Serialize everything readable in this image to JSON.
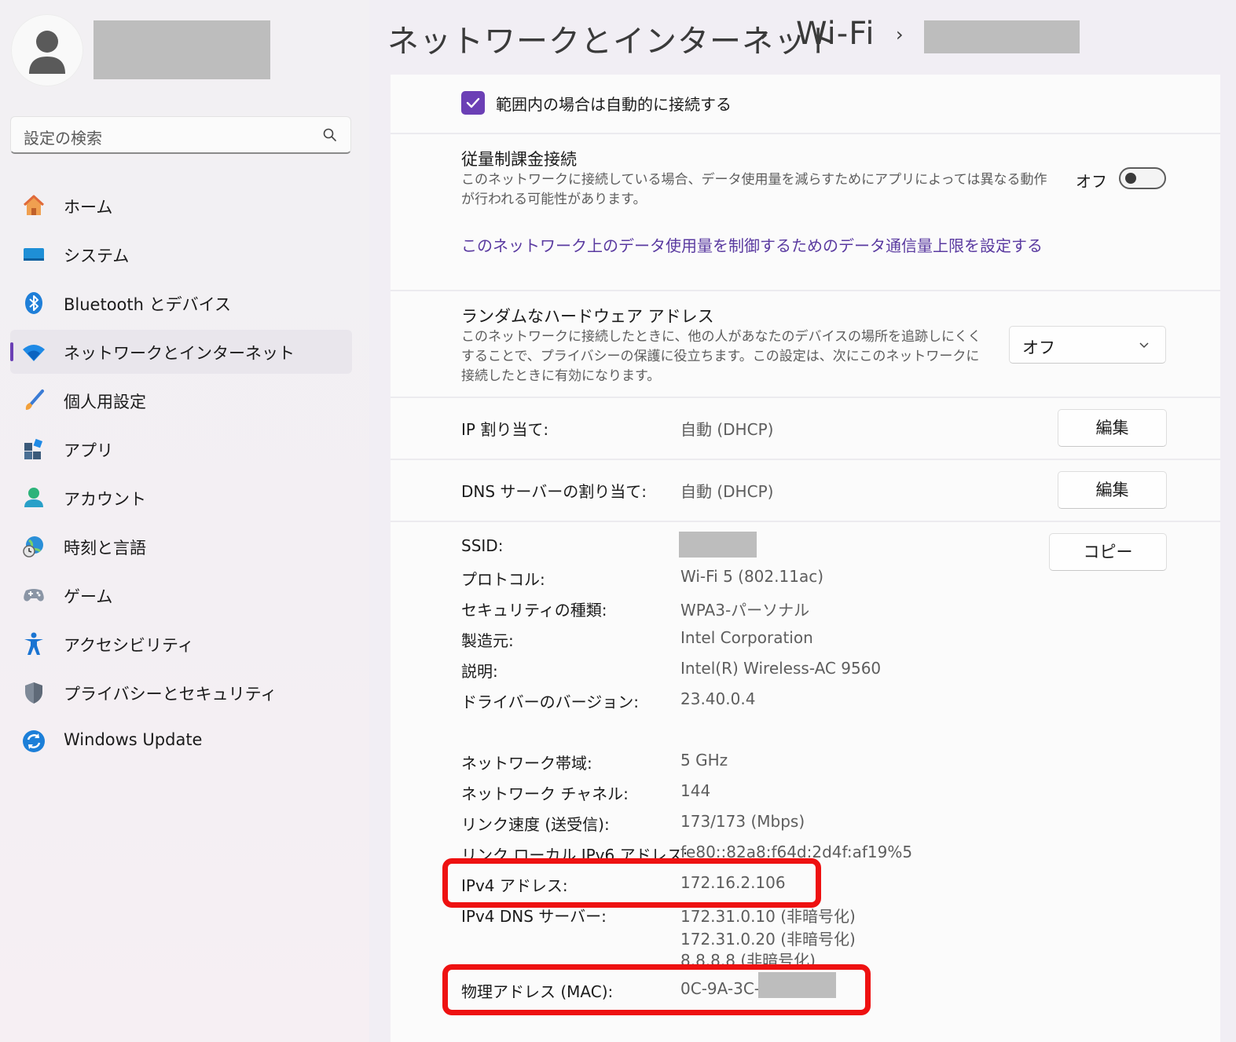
{
  "breadcrumb": {
    "part1": "ネットワークとインターネット",
    "sep": "›",
    "part2": "Wi-Fi"
  },
  "search": {
    "placeholder": "設定の検索"
  },
  "nav": [
    {
      "label": "ホーム",
      "icon": "home-icon"
    },
    {
      "label": "システム",
      "icon": "display-icon"
    },
    {
      "label": "Bluetooth とデバイス",
      "icon": "bluetooth-icon"
    },
    {
      "label": "ネットワークとインターネット",
      "icon": "wifi-icon",
      "active": true
    },
    {
      "label": "個人用設定",
      "icon": "brush-icon"
    },
    {
      "label": "アプリ",
      "icon": "apps-icon"
    },
    {
      "label": "アカウント",
      "icon": "account-icon"
    },
    {
      "label": "時刻と言語",
      "icon": "globe-clock-icon"
    },
    {
      "label": "ゲーム",
      "icon": "gamepad-icon"
    },
    {
      "label": "アクセシビリティ",
      "icon": "accessibility-icon"
    },
    {
      "label": "プライバシーとセキュリティ",
      "icon": "shield-icon"
    },
    {
      "label": "Windows Update",
      "icon": "update-icon"
    }
  ],
  "auto_connect": {
    "label": "範囲内の場合は自動的に接続する",
    "checked": true
  },
  "metered": {
    "title": "従量制課金接続",
    "desc": "このネットワークに接続している場合、データ使用量を減らすためにアプリによっては異なる動作が行われる可能性があります。",
    "state_label": "オフ",
    "link": "このネットワーク上のデータ使用量を制御するためのデータ通信量上限を設定する"
  },
  "random_hw": {
    "title": "ランダムなハードウェア アドレス",
    "desc": "このネットワークに接続したときに、他の人があなたのデバイスの場所を追跡しにくくすることで、プライバシーの保護に役立ちます。この設定は、次にこのネットワークに接続したときに有効になります。",
    "selected": "オフ"
  },
  "ip_assign": {
    "label": "IP 割り当て:",
    "value": "自動 (DHCP)",
    "button": "編集"
  },
  "dns_assign": {
    "label": "DNS サーバーの割り当て:",
    "value": "自動 (DHCP)",
    "button": "編集"
  },
  "copy_button": "コピー",
  "props": {
    "ssid_label": "SSID:",
    "protocol_label": "プロトコル:",
    "protocol": "Wi-Fi 5 (802.11ac)",
    "security_label": "セキュリティの種類:",
    "security": "WPA3-パーソナル",
    "manufacturer_label": "製造元:",
    "manufacturer": "Intel Corporation",
    "description_label": "説明:",
    "description": "Intel(R) Wireless-AC 9560",
    "driver_label": "ドライバーのバージョン:",
    "driver": "23.40.0.4",
    "band_label": "ネットワーク帯域:",
    "band": "5 GHz",
    "channel_label": "ネットワーク チャネル:",
    "channel": "144",
    "speed_label": "リンク速度 (送受信):",
    "speed": "173/173 (Mbps)",
    "ipv6_label": "リンク ローカル IPv6 アドレス:",
    "ipv6": "fe80::82a8:f64d:2d4f:af19%5",
    "ipv4_label": "IPv4 アドレス:",
    "ipv4": "172.16.2.106",
    "dns_label": "IPv4 DNS サーバー:",
    "dns1": "172.31.0.10 (非暗号化)",
    "dns2": "172.31.0.20 (非暗号化)",
    "dns3": "8.8.8.8 (非暗号化)",
    "mac_label": "物理アドレス (MAC):",
    "mac": "0C-9A-3C-"
  },
  "colors": {
    "accent": "#6b3fb5",
    "highlight": "#ee1111",
    "link": "#5a3aa0"
  }
}
